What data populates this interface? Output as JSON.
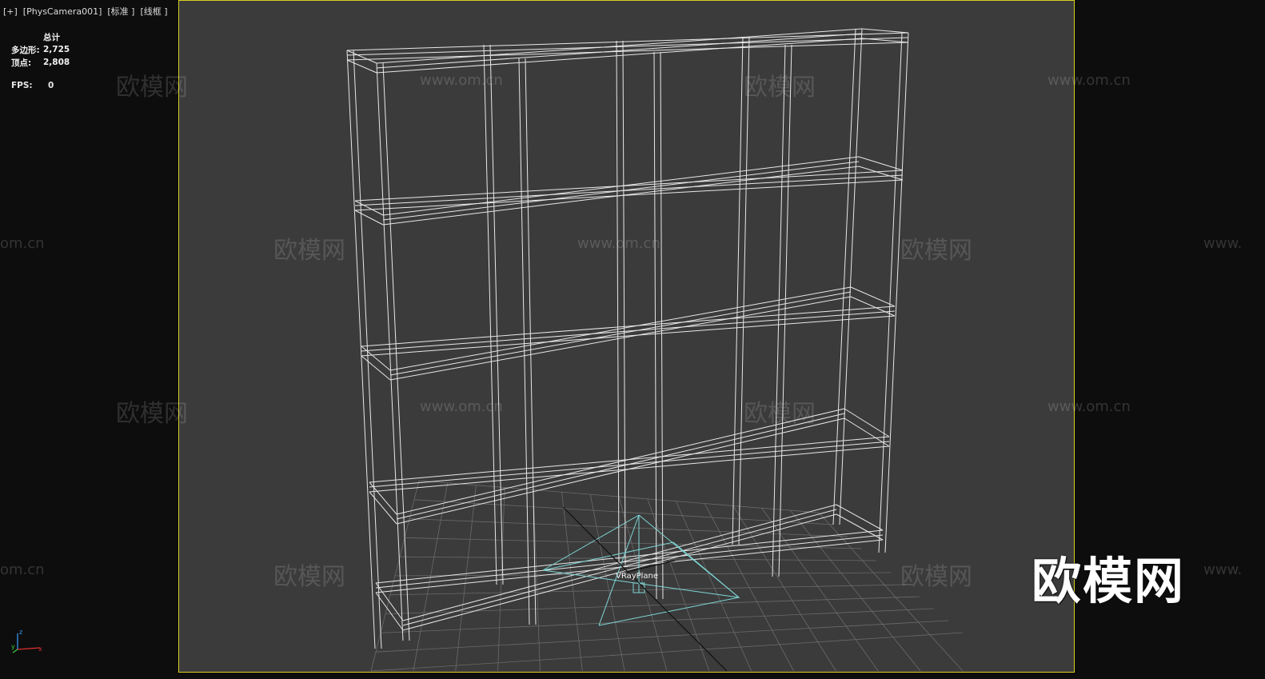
{
  "viewport": {
    "label": "[+]  [PhysCamera001]  [标准 ]  [线框 ]"
  },
  "stats": {
    "header": "总计",
    "polygons_label": "多边形:",
    "polygons_value": "2,725",
    "vertices_label": "顶点:",
    "vertices_value": "2,808",
    "fps_label": "FPS:",
    "fps_value": "0"
  },
  "scene": {
    "object_label": "VRayPlane",
    "wireframe_color": "#e8e8e8",
    "helper_color": "#7fd6d6",
    "grid_color": "#6a6a6a",
    "frame_color": "#d7cf21",
    "background_color": "#3b3b3b"
  },
  "watermarks": {
    "url": "www.om.cn",
    "url_cut": "om.cn",
    "url_prefix": "www.",
    "cn": "欧模网",
    "cn_cut": "欧模网",
    "logo": "欧模网"
  },
  "gizmo": {
    "z": "z",
    "y": "y",
    "x": "x"
  }
}
